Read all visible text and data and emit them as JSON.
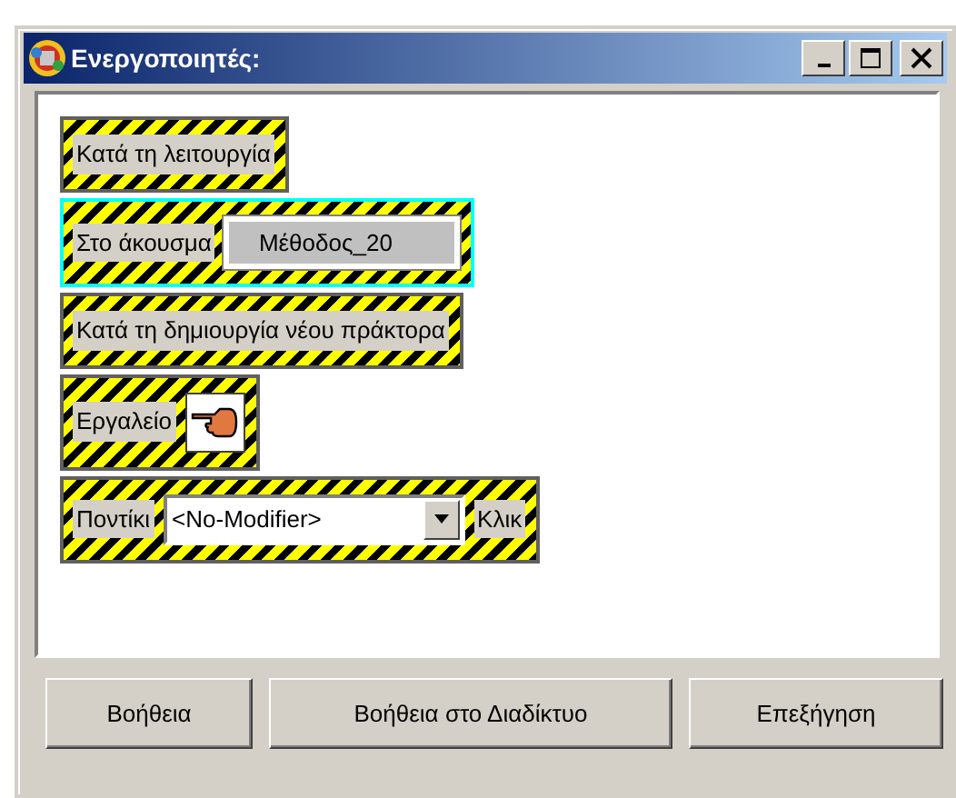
{
  "window": {
    "title": "Ενεργοποιητές:"
  },
  "triggers": [
    {
      "selected": false,
      "parts": [
        {
          "kind": "label",
          "text": "Κατά τη λειτουργία"
        }
      ]
    },
    {
      "selected": true,
      "parts": [
        {
          "kind": "label",
          "text": "Στο άκουσμα"
        },
        {
          "kind": "field",
          "value": "Μέθοδος_20"
        }
      ]
    },
    {
      "selected": false,
      "parts": [
        {
          "kind": "label",
          "text": "Κατά τη δημιουργία νέου πράκτορα"
        }
      ]
    },
    {
      "selected": false,
      "parts": [
        {
          "kind": "label",
          "text": "Εργαλείο"
        },
        {
          "kind": "tool"
        }
      ]
    },
    {
      "selected": false,
      "parts": [
        {
          "kind": "label",
          "text": "Ποντίκι"
        },
        {
          "kind": "dropdown",
          "value": "<No-Modifier>"
        },
        {
          "kind": "label",
          "text": "Κλικ"
        }
      ]
    }
  ],
  "buttons": [
    "Βοήθεια",
    "Βοήθεια στο Διαδίκτυο",
    "Επεξήγηση"
  ]
}
